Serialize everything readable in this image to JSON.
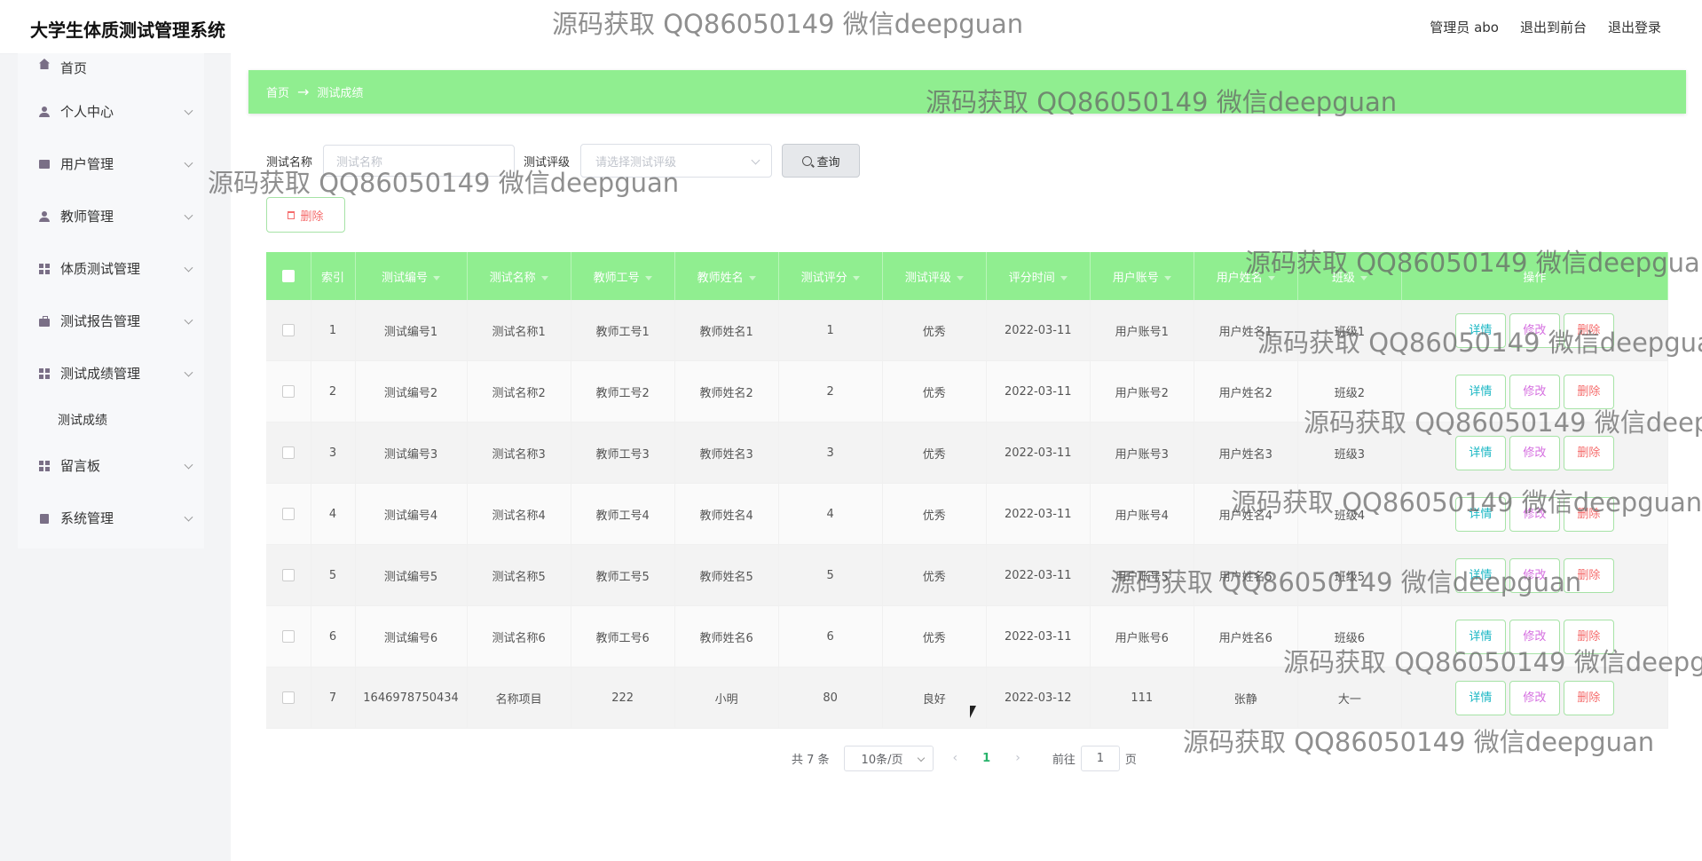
{
  "header": {
    "app_title": "大学生体质测试管理系统",
    "admin_label": "管理员 abo",
    "to_front_label": "退出到前台",
    "logout_label": "退出登录"
  },
  "sidebar": {
    "home": "首页",
    "items": [
      {
        "label": "个人中心",
        "icon": "user-icon"
      },
      {
        "label": "用户管理",
        "icon": "box-icon"
      },
      {
        "label": "教师管理",
        "icon": "user-icon"
      },
      {
        "label": "体质测试管理",
        "icon": "grid-icon"
      },
      {
        "label": "测试报告管理",
        "icon": "briefcase-icon"
      },
      {
        "label": "测试成绩管理",
        "icon": "grid-icon",
        "expanded": true,
        "children": [
          "测试成绩"
        ]
      },
      {
        "label": "留言板",
        "icon": "grid-icon"
      },
      {
        "label": "系统管理",
        "icon": "clipboard-icon"
      }
    ]
  },
  "breadcrumb": {
    "home": "首页",
    "separator": "→",
    "current": "测试成绩"
  },
  "filters": {
    "name_label": "测试名称",
    "name_placeholder": "测试名称",
    "level_label": "测试评级",
    "level_placeholder": "请选择测试评级",
    "query_button": "查询"
  },
  "toolbar": {
    "delete_button": "删除"
  },
  "table": {
    "columns": [
      "索引",
      "测试编号",
      "测试名称",
      "教师工号",
      "教师姓名",
      "测试评分",
      "测试评级",
      "评分时间",
      "用户账号",
      "用户姓名",
      "班级",
      "操作"
    ],
    "rows": [
      {
        "index": "1",
        "test_no": "测试编号1",
        "test_name": "测试名称1",
        "teacher_id": "教师工号1",
        "teacher_name": "教师姓名1",
        "score": "1",
        "grade": "优秀",
        "date": "2022-03-11",
        "account": "用户账号1",
        "user_name": "用户姓名1",
        "class": "班级1"
      },
      {
        "index": "2",
        "test_no": "测试编号2",
        "test_name": "测试名称2",
        "teacher_id": "教师工号2",
        "teacher_name": "教师姓名2",
        "score": "2",
        "grade": "优秀",
        "date": "2022-03-11",
        "account": "用户账号2",
        "user_name": "用户姓名2",
        "class": "班级2"
      },
      {
        "index": "3",
        "test_no": "测试编号3",
        "test_name": "测试名称3",
        "teacher_id": "教师工号3",
        "teacher_name": "教师姓名3",
        "score": "3",
        "grade": "优秀",
        "date": "2022-03-11",
        "account": "用户账号3",
        "user_name": "用户姓名3",
        "class": "班级3"
      },
      {
        "index": "4",
        "test_no": "测试编号4",
        "test_name": "测试名称4",
        "teacher_id": "教师工号4",
        "teacher_name": "教师姓名4",
        "score": "4",
        "grade": "优秀",
        "date": "2022-03-11",
        "account": "用户账号4",
        "user_name": "用户姓名4",
        "class": "班级4"
      },
      {
        "index": "5",
        "test_no": "测试编号5",
        "test_name": "测试名称5",
        "teacher_id": "教师工号5",
        "teacher_name": "教师姓名5",
        "score": "5",
        "grade": "优秀",
        "date": "2022-03-11",
        "account": "用户账号5",
        "user_name": "用户姓名5",
        "class": "班级5"
      },
      {
        "index": "6",
        "test_no": "测试编号6",
        "test_name": "测试名称6",
        "teacher_id": "教师工号6",
        "teacher_name": "教师姓名6",
        "score": "6",
        "grade": "优秀",
        "date": "2022-03-11",
        "account": "用户账号6",
        "user_name": "用户姓名6",
        "class": "班级6"
      },
      {
        "index": "7",
        "test_no": "1646978750434",
        "test_name": "名称项目",
        "teacher_id": "222",
        "teacher_name": "小明",
        "score": "80",
        "grade": "良好",
        "date": "2022-03-12",
        "account": "111",
        "user_name": "张静",
        "class": "大一"
      }
    ],
    "actions": {
      "detail": "详情",
      "edit": "修改",
      "delete": "删除"
    }
  },
  "pagination": {
    "total": "共 7 条",
    "page_size": "10条/页",
    "current_page": "1",
    "goto_prefix": "前往",
    "goto_value": "1",
    "goto_suffix": "页"
  },
  "watermark": "源码获取 QQ86050149 微信deepguan",
  "colors": {
    "accent_green": "#90ee90",
    "delete_red": "#f56c6c",
    "detail_cyan": "#1ab7c4",
    "edit_purple": "#d56ee0"
  }
}
